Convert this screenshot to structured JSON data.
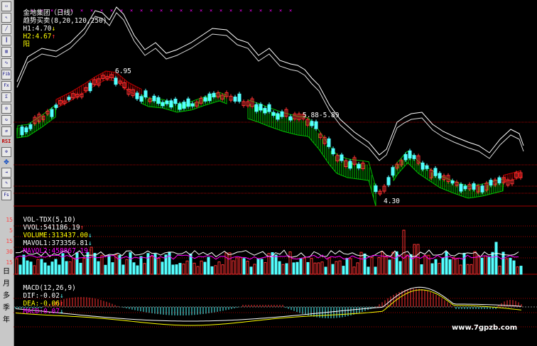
{
  "main_header": {
    "stock_name": "金地集团（日线）",
    "indicator_name": "趋势买卖",
    "indicator_params": "(8,20,120,250)",
    "h1_label": "H1:",
    "h1_value": "4.70",
    "h1_arrow": "↓",
    "h2_label": "H2:",
    "h2_value": "4.67",
    "h2_arrow": "↑",
    "extra_label": "阳"
  },
  "price_annotations": {
    "high": "6.95",
    "mid": "5.88-5.89",
    "low": "4.30"
  },
  "volume_header": {
    "name": "VOL-TDX(5,10)",
    "vvol_label": "VVOL:",
    "vvol_value": "541186.19",
    "vvol_arrow": "↑",
    "volume_label": "VOLUME:",
    "volume_value": "313437.00",
    "volume_arrow": "↓",
    "mavol1_label": "MAVOL1:",
    "mavol1_value": "373356.81",
    "mavol1_arrow": "↓",
    "mavol2_label": "MAVOL2:",
    "mavol2_value": "458867.19",
    "mavol2_arrow": "↑"
  },
  "volume_axis": [
    "15",
    "5",
    "15",
    "30",
    "15"
  ],
  "macd_header": {
    "name": "MACD(12,26,9)",
    "dif_label": "DIF:",
    "dif_value": "-0.02",
    "dif_arrow": "↓",
    "dea_label": "DEA:",
    "dea_value": "-0.06",
    "dea_arrow": "↑",
    "macd_label": "MACD:",
    "macd_value": "0.07",
    "macd_arrow": "↓"
  },
  "period_buttons": [
    "日",
    "月",
    "多",
    "季",
    "年"
  ],
  "toolbar_icons": [
    "select-icon",
    "cursor-icon",
    "line-chart-icon",
    "candlestick-icon",
    "bar-chart-icon",
    "indicator-icon",
    "fibonacci-icon",
    "fx-icon",
    "formula-icon",
    "search-icon",
    "refresh-icon",
    "compare-icon",
    "rsi-icon",
    "zoom-icon",
    "move-icon",
    "export-icon",
    "pencil-icon",
    "function-icon"
  ],
  "toolbar_texts": {
    "fib": "Fib",
    "fx": "Fx",
    "fs": "Fs",
    "rsi": "RSI"
  },
  "watermark": "www.7gpzb.com",
  "colors": {
    "up": "#ff3232",
    "down": "#54ffff",
    "line_white": "#ffffff",
    "line_yellow": "#ffff00",
    "line_magenta": "#ff00ff",
    "band_green": "#00c000",
    "band_red": "#c00000",
    "grid": "#a00000"
  }
}
